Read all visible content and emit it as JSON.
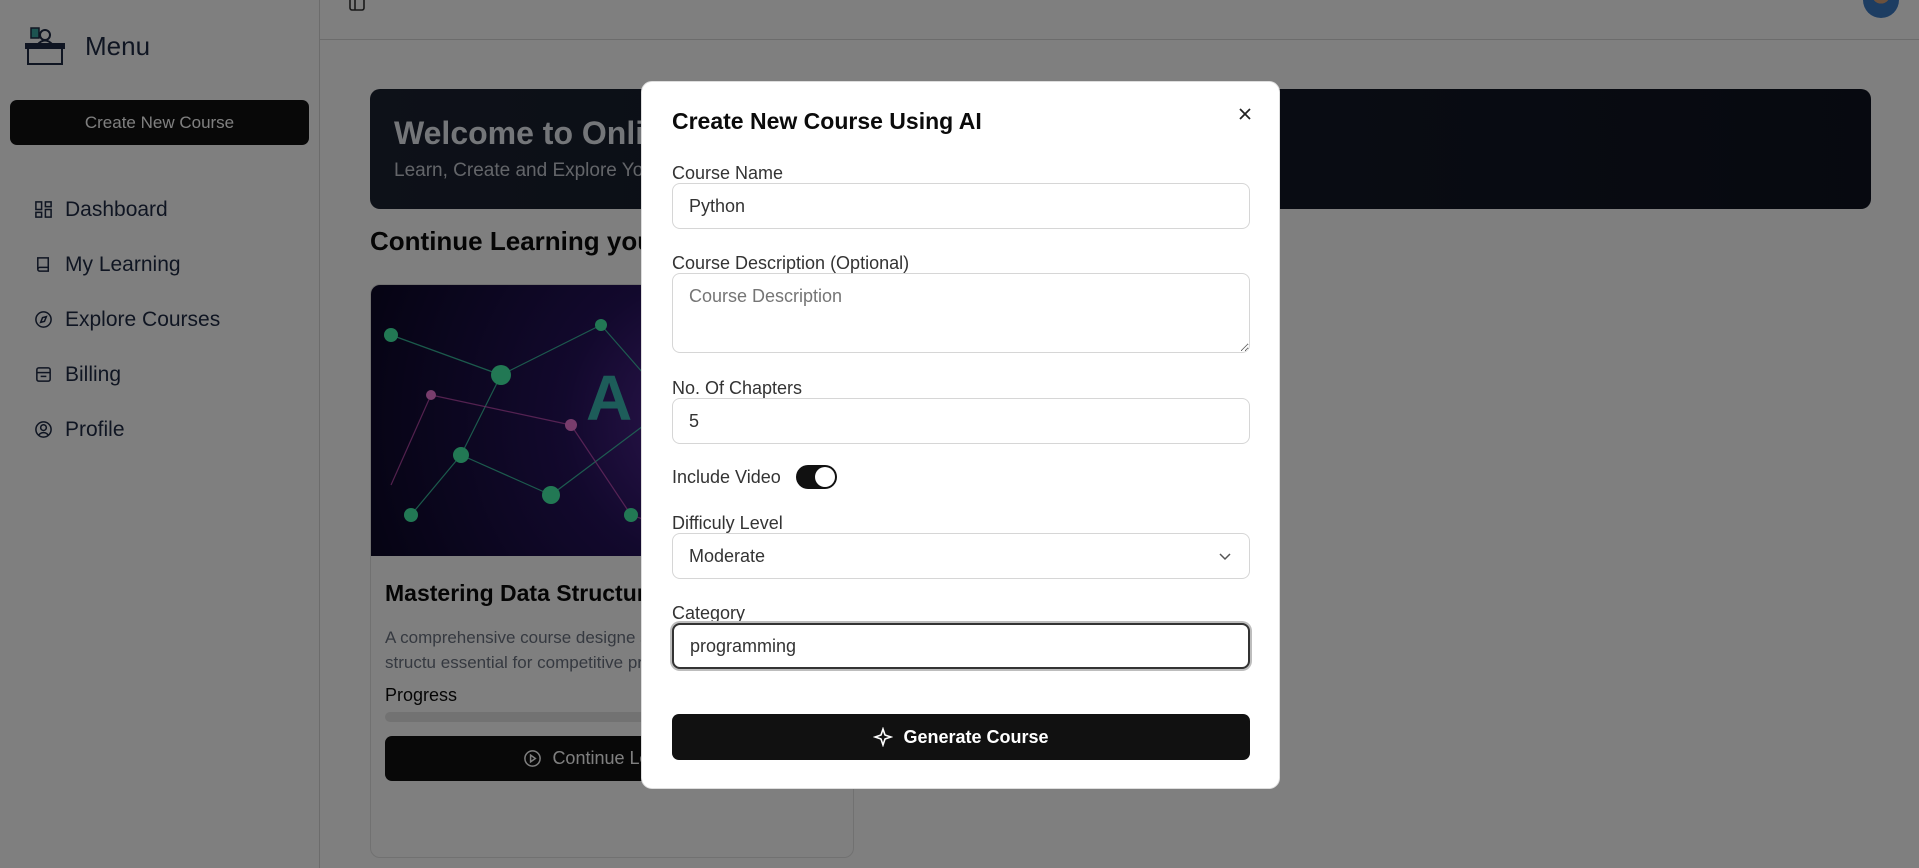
{
  "sidebar": {
    "title": "Menu",
    "create_button": "Create New Course",
    "items": [
      {
        "label": "Dashboard",
        "icon": "dashboard-icon"
      },
      {
        "label": "My Learning",
        "icon": "book-icon"
      },
      {
        "label": "Explore Courses",
        "icon": "compass-icon"
      },
      {
        "label": "Billing",
        "icon": "wallet-icon"
      },
      {
        "label": "Profile",
        "icon": "user-circle-icon"
      }
    ]
  },
  "banner": {
    "title": "Welcome to Onlin",
    "subtitle": "Learn, Create and Explore Yo"
  },
  "section_title": "Continue Learning you",
  "course_card": {
    "title": "Mastering Data Structur (DSA)",
    "description": "A comprehensive course designe strong foundation in data structu essential for competitive program",
    "progress_label": "Progress",
    "progress": 0,
    "continue_button": "Continue Learning"
  },
  "modal": {
    "title": "Create New Course Using AI",
    "course_name_label": "Course Name",
    "course_name_value": "Python",
    "description_label": "Course Description (Optional)",
    "description_placeholder": "Course Description",
    "chapters_label": "No. Of Chapters",
    "chapters_value": "5",
    "include_video_label": "Include Video",
    "include_video": true,
    "difficulty_label": "Difficuly Level",
    "difficulty_value": "Moderate",
    "category_label": "Category",
    "category_value": "programming",
    "generate_button": "Generate Course"
  }
}
